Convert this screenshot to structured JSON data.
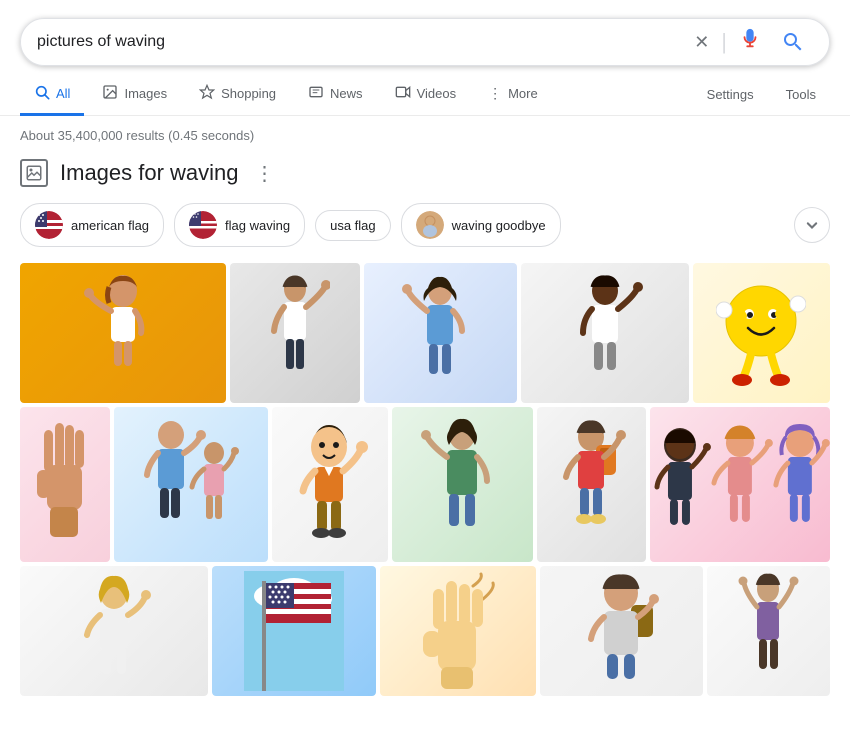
{
  "search": {
    "query": "pictures of waving",
    "results_count": "About 35,400,000 results (0.45 seconds)"
  },
  "nav": {
    "tabs": [
      {
        "id": "all",
        "label": "All",
        "icon": "🔍",
        "active": true
      },
      {
        "id": "images",
        "label": "Images",
        "icon": "🖼"
      },
      {
        "id": "shopping",
        "label": "Shopping",
        "icon": "◇"
      },
      {
        "id": "news",
        "label": "News",
        "icon": "▦"
      },
      {
        "id": "videos",
        "label": "Videos",
        "icon": "▶"
      },
      {
        "id": "more",
        "label": "More",
        "icon": "⋮"
      }
    ],
    "settings": "Settings",
    "tools": "Tools"
  },
  "images_section": {
    "title": "Images for waving"
  },
  "chips": [
    {
      "id": "american-flag",
      "label": "american flag",
      "has_img": true
    },
    {
      "id": "flag-waving",
      "label": "flag waving",
      "has_img": true
    },
    {
      "id": "usa-flag",
      "label": "usa flag",
      "has_img": false
    },
    {
      "id": "waving-goodbye",
      "label": "waving goodbye",
      "has_img": true
    }
  ],
  "icons": {
    "close": "✕",
    "mic": "🎤",
    "search": "🔍",
    "chevron_down": "⌄",
    "dots_vertical": "⋮",
    "image_icon": "⊡"
  }
}
